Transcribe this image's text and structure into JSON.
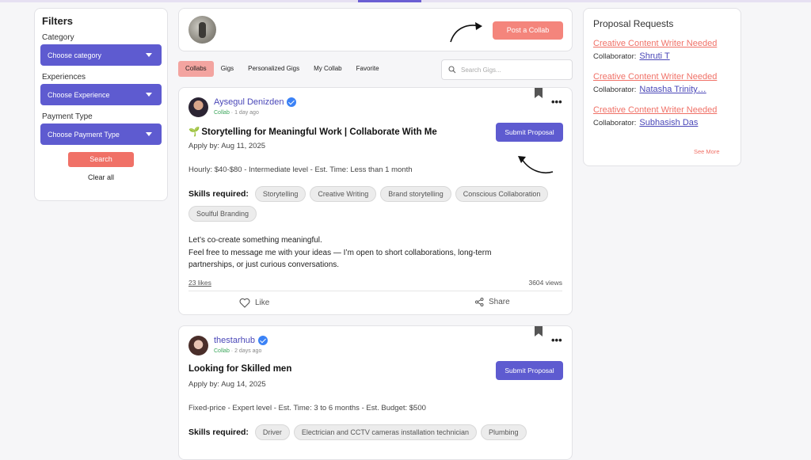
{
  "filters": {
    "title": "Filters",
    "category_label": "Category",
    "category_value": "Choose category",
    "experience_label": "Experiences",
    "experience_value": "Choose Experience",
    "payment_label": "Payment Type",
    "payment_value": "Choose Payment Type",
    "search_label": "Search",
    "clear_label": "Clear all"
  },
  "postbar": {
    "post_label": "Post a Collab"
  },
  "tabs": [
    "Collabs",
    "Gigs",
    "Personalized Gigs",
    "My Collab",
    "Favorite"
  ],
  "search": {
    "placeholder": "Search Gigs..."
  },
  "gigs": [
    {
      "author": "Aysegul Denizden",
      "type": "Collab",
      "time": "1 day ago",
      "title_icon": "🌱",
      "title": "Storytelling for Meaningful Work | Collaborate With Me",
      "apply_by": "Apply by: Aug 11, 2025",
      "submit_label": "Submit Proposal",
      "details": "Hourly: $40-$80 - Intermediate level - Est. Time: Less than 1 month",
      "skills_label": "Skills required:",
      "skills": [
        "Storytelling",
        "Creative Writing",
        "Brand storytelling",
        "Conscious Collaboration",
        "Soulful Branding"
      ],
      "description": [
        "Let’s co-create something meaningful.",
        "Feel free to message me with your ideas — I’m open to short collaborations, long-term partnerships, or just curious conversations."
      ],
      "likes": "23 likes",
      "views": "3604 views",
      "like_label": "Like",
      "share_label": "Share"
    },
    {
      "author": "thestarhub",
      "type": "Collab",
      "time": "2 days ago",
      "title": "Looking for Skilled men",
      "apply_by": "Apply by: Aug 14, 2025",
      "submit_label": "Submit Proposal",
      "details": "Fixed-price - Expert level - Est. Time: 3 to 6 months - Est. Budget: $500",
      "skills_label": "Skills required:",
      "skills": [
        "Driver",
        "Electrician and CCTV cameras installation technician",
        "Plumbing"
      ]
    }
  ],
  "proposals": {
    "title": "Proposal Requests",
    "collaborator_label": "Collaborator:",
    "items": [
      {
        "title": "Creative Content Writer Needed",
        "collaborator": "Shruti T"
      },
      {
        "title": "Creative Content Writer Needed",
        "collaborator": "Natasha Trinity…"
      },
      {
        "title": "Creative Content Writer Needed",
        "collaborator": "Subhasish Das"
      }
    ],
    "see_more": "See More"
  },
  "colors": {
    "accent": "#5e5bd0",
    "coral": "#f07167",
    "verified": "#3b82f6",
    "collab_green": "#3aa55a"
  },
  "icons": [
    "search-icon",
    "verified-badge-icon",
    "bookmark-icon",
    "more-icon",
    "heart-icon",
    "share-icon",
    "chevron-down-icon",
    "arrow-icon"
  ]
}
